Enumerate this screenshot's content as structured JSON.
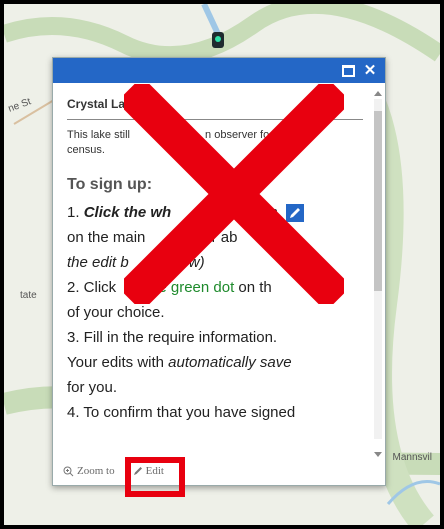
{
  "map": {
    "labels": {
      "mannsville": "Mannsvil",
      "left_road": "ne St",
      "left_small": "tate"
    }
  },
  "popup": {
    "title": "Crystal Lak",
    "description": "This lake still needs an observer for this census.",
    "description_visible": "This lake still",
    "description_visible_2": "n observer fo",
    "description_visible_3": "census.",
    "signup_heading": "To sign up:",
    "step1_a": "1. ",
    "step1_b": "Click the wh",
    "step1_c": "on",
    "step1_d": " on the main ",
    "step1_e": "r ab",
    "step1_f": "t",
    "step1_g": "the edit b",
    "step1_h": "elow)",
    "step2_a": "2. Click ",
    "step2_b": "e green dot",
    "step2_c": " on th",
    "step2_d": "of your choice.",
    "step3_a": "3. Fill in the require information.",
    "step3_b": "Your edits with ",
    "step3_c": "automatically save",
    "step3_d": "for you.",
    "step4": "4. To confirm that you have signed",
    "footer": {
      "zoom_label": "Zoom to",
      "edit_label": "Edit"
    }
  },
  "colors": {
    "header": "#2467c6",
    "annotation": "#e8000f",
    "green_text": "#1e8a2c"
  },
  "icons": {
    "maximize": "maximize-icon",
    "close": "close-icon",
    "zoom": "zoom-icon",
    "edit": "pencil-icon"
  }
}
